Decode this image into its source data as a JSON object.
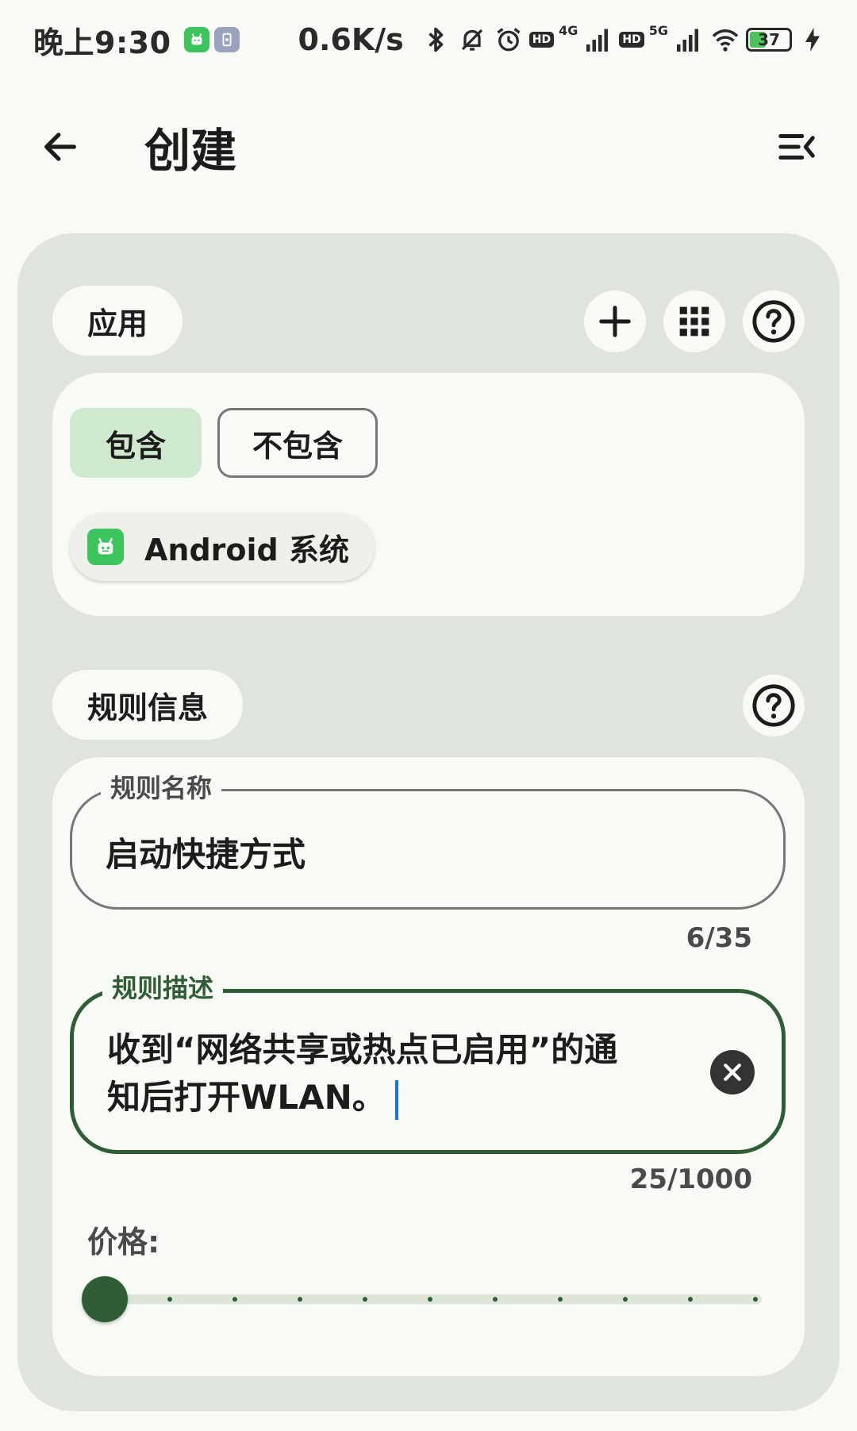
{
  "status_bar": {
    "time": "晚上9:30",
    "net_speed": "0.6K/s",
    "hd_label": "HD",
    "network_4g": "4G",
    "network_5g": "5G",
    "battery": "37",
    "icons": [
      "app-notification-icon",
      "screen-record-icon",
      "bluetooth-icon",
      "mute-bell-icon",
      "alarm-icon",
      "signal-icon",
      "wifi-icon",
      "battery-icon",
      "charging-icon"
    ]
  },
  "app_bar": {
    "title": "创建",
    "back_icon": "arrow-back-icon",
    "menu_icon": "menu-collapse-icon"
  },
  "apps_section": {
    "heading": "应用",
    "include_label": "包含",
    "exclude_label": "不包含",
    "selected_mode": "包含",
    "chip_label": "Android 系统",
    "actions": [
      "add-icon",
      "grid-icon",
      "help-icon"
    ]
  },
  "rule_info": {
    "heading": "规则信息",
    "name_field": {
      "label": "规则名称",
      "value": "启动快捷方式",
      "counter": "6/35"
    },
    "desc_field": {
      "label": "规则描述",
      "value_line1": "收到“网络共享或热点已启用”的通",
      "value_line2": "知后打开WLAN。",
      "counter": "25/1000"
    },
    "price_label": "价格:",
    "price_slider": {
      "value": 0,
      "min": 0,
      "max": 10,
      "steps": 10
    }
  },
  "colors": {
    "accent": "#2f5e35",
    "selected_bg": "#cfe9cf",
    "panel_bg": "#dfe4dc",
    "surface": "#f8faf5",
    "app_icon_green": "#3ec45c",
    "cursor": "#1976d2"
  }
}
